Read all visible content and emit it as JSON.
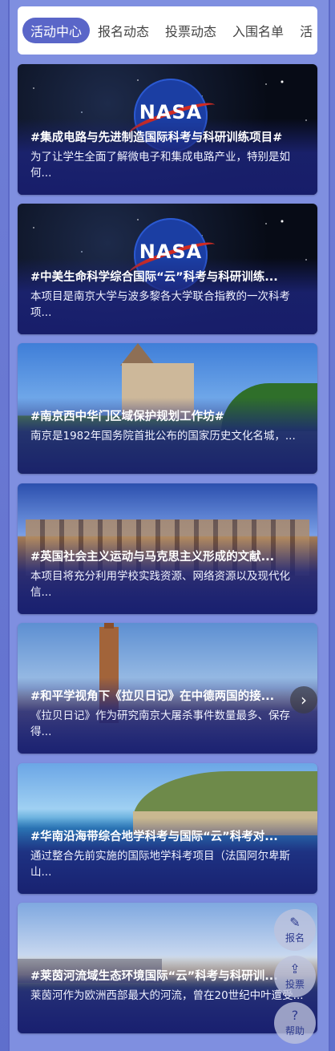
{
  "tabs": [
    {
      "label": "活动中心",
      "active": true
    },
    {
      "label": "报名动态",
      "active": false
    },
    {
      "label": "投票动态",
      "active": false
    },
    {
      "label": "入围名单",
      "active": false
    },
    {
      "label": "活",
      "active": false
    }
  ],
  "cards": [
    {
      "title": "#集成电路与先进制造国际科考与科研训练项目#",
      "desc": "为了让学生全面了解微电子和集成电路产业，特别是如何...",
      "image": "nasa-logo",
      "image_text": "NASA"
    },
    {
      "title": "#中美生命科学综合国际“云”科考与科研训练...",
      "desc": "本项目是南京大学与波多黎各大学联合指教的一次科考项...",
      "image": "nasa-logo",
      "image_text": "NASA"
    },
    {
      "title": "#南京西中华门区域保护规划工作坊#",
      "desc": "南京是1982年国务院首批公布的国家历史文化名城，...",
      "image": "castle"
    },
    {
      "title": "#英国社会主义运动与马克思主义形成的文献...",
      "desc": "本项目将充分利用学校实践资源、网络资源以及现代化信...",
      "image": "historic-hall"
    },
    {
      "title": "#和平学视角下《拉贝日记》在中德两国的接...",
      "desc": "《拉贝日记》作为研究南京大屠杀事件数量最多、保存得...",
      "image": "tower-sunset"
    },
    {
      "title": "#华南沿海带综合地学科考与国际“云”科考对...",
      "desc": "通过整合先前实施的国际地学科考项目（法国阿尔卑斯山...",
      "image": "coast"
    },
    {
      "title": "#莱茵河流域生态环境国际“云”科考与科研训...",
      "desc": "莱茵河作为欧洲西部最大的河流，曾在20世纪中叶遭受...",
      "image": "river"
    }
  ],
  "floating": {
    "register_label": "报名",
    "vote_label": "投票",
    "help_label": "帮助"
  },
  "next_icon": "›"
}
